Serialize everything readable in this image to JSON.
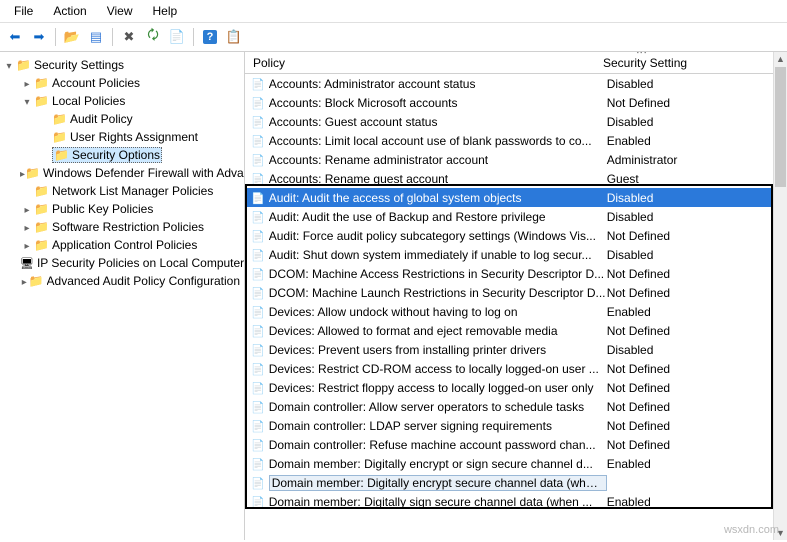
{
  "menu": {
    "file": "File",
    "action": "Action",
    "view": "View",
    "help": "Help"
  },
  "columns": {
    "policy": "Policy",
    "setting": "Security Setting"
  },
  "tree": [
    {
      "level": 0,
      "tw": "open",
      "icon": "folder",
      "label": "Security Settings"
    },
    {
      "level": 1,
      "tw": "closed",
      "icon": "folder",
      "label": "Account Policies"
    },
    {
      "level": 1,
      "tw": "open",
      "icon": "folder",
      "label": "Local Policies"
    },
    {
      "level": 2,
      "tw": "none",
      "icon": "folder",
      "label": "Audit Policy"
    },
    {
      "level": 2,
      "tw": "none",
      "icon": "folder",
      "label": "User Rights Assignment"
    },
    {
      "level": 2,
      "tw": "none",
      "icon": "folder",
      "label": "Security Options",
      "selected": true
    },
    {
      "level": 1,
      "tw": "closed",
      "icon": "folder",
      "label": "Windows Defender Firewall with Advanced Security"
    },
    {
      "level": 1,
      "tw": "none",
      "icon": "folder",
      "label": "Network List Manager Policies"
    },
    {
      "level": 1,
      "tw": "closed",
      "icon": "folder",
      "label": "Public Key Policies"
    },
    {
      "level": 1,
      "tw": "closed",
      "icon": "folder",
      "label": "Software Restriction Policies"
    },
    {
      "level": 1,
      "tw": "closed",
      "icon": "folder",
      "label": "Application Control Policies"
    },
    {
      "level": 1,
      "tw": "none",
      "icon": "computer",
      "label": "IP Security Policies on Local Computer"
    },
    {
      "level": 1,
      "tw": "closed",
      "icon": "folder",
      "label": "Advanced Audit Policy Configuration"
    }
  ],
  "policies": [
    {
      "name": "Accounts: Administrator account status",
      "setting": "Disabled"
    },
    {
      "name": "Accounts: Block Microsoft accounts",
      "setting": "Not Defined"
    },
    {
      "name": "Accounts: Guest account status",
      "setting": "Disabled"
    },
    {
      "name": "Accounts: Limit local account use of blank passwords to co...",
      "setting": "Enabled"
    },
    {
      "name": "Accounts: Rename administrator account",
      "setting": "Administrator"
    },
    {
      "name": "Accounts: Rename guest account",
      "setting": "Guest"
    },
    {
      "name": "Audit: Audit the access of global system objects",
      "setting": "Disabled",
      "selected": true
    },
    {
      "name": "Audit: Audit the use of Backup and Restore privilege",
      "setting": "Disabled"
    },
    {
      "name": "Audit: Force audit policy subcategory settings (Windows Vis...",
      "setting": "Not Defined"
    },
    {
      "name": "Audit: Shut down system immediately if unable to log secur...",
      "setting": "Disabled"
    },
    {
      "name": "DCOM: Machine Access Restrictions in Security Descriptor D...",
      "setting": "Not Defined"
    },
    {
      "name": "DCOM: Machine Launch Restrictions in Security Descriptor D...",
      "setting": "Not Defined"
    },
    {
      "name": "Devices: Allow undock without having to log on",
      "setting": "Enabled"
    },
    {
      "name": "Devices: Allowed to format and eject removable media",
      "setting": "Not Defined"
    },
    {
      "name": "Devices: Prevent users from installing printer drivers",
      "setting": "Disabled"
    },
    {
      "name": "Devices: Restrict CD-ROM access to locally logged-on user ...",
      "setting": "Not Defined"
    },
    {
      "name": "Devices: Restrict floppy access to locally logged-on user only",
      "setting": "Not Defined"
    },
    {
      "name": "Domain controller: Allow server operators to schedule tasks",
      "setting": "Not Defined"
    },
    {
      "name": "Domain controller: LDAP server signing requirements",
      "setting": "Not Defined"
    },
    {
      "name": "Domain controller: Refuse machine account password chan...",
      "setting": "Not Defined"
    },
    {
      "name": "Domain member: Digitally encrypt or sign secure channel d...",
      "setting": "Enabled"
    },
    {
      "name": "Domain member: Digitally encrypt secure channel data (when possible)",
      "setting": "",
      "hover": true
    },
    {
      "name": "Domain member: Digitally sign secure channel data (when ...",
      "setting": "Enabled"
    }
  ],
  "highlight": {
    "top_row": 6,
    "bottom_row": 22
  },
  "watermark": "wsxdn.com"
}
